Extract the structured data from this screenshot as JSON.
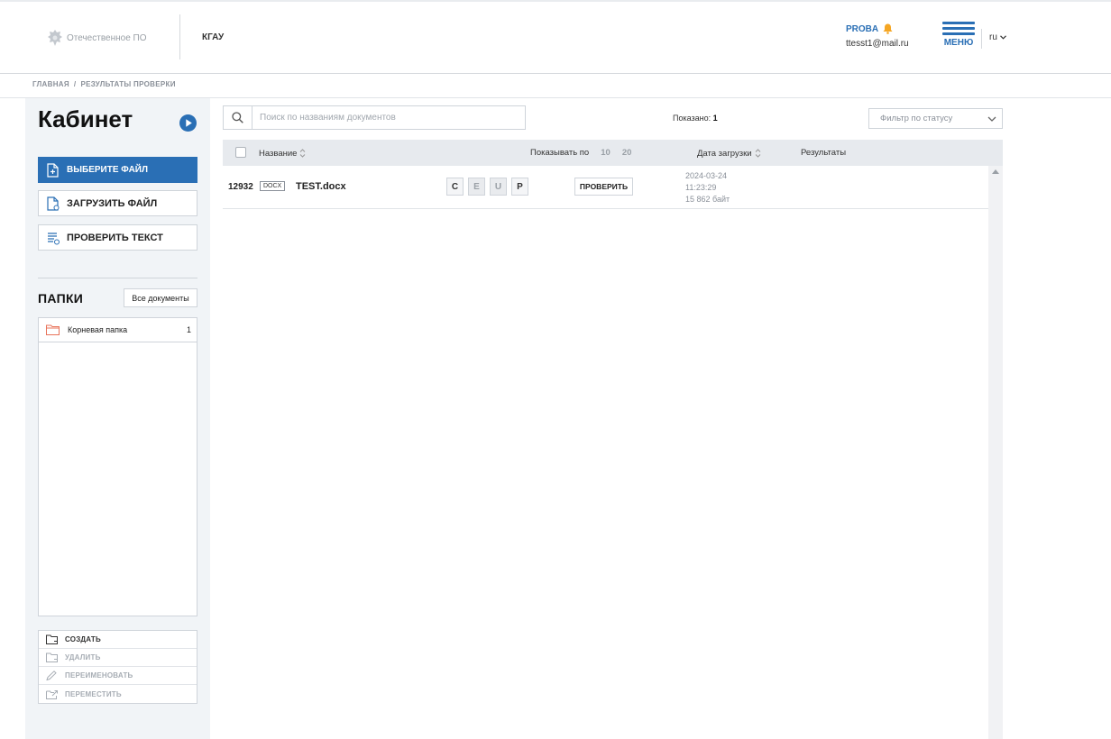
{
  "header": {
    "logo_text": "Отечественное ПО",
    "org": "КГАУ",
    "account_name": "PROBA",
    "account_email": "ttesst1@mail.ru",
    "menu_label": "МЕНЮ",
    "language": "ru",
    "accent_color": "#2a6fb5",
    "bell_color": "#f5a623"
  },
  "breadcrumb": {
    "home": "ГЛАВНАЯ",
    "separator": "/",
    "current": "РЕЗУЛЬТАТЫ ПРОВЕРКИ"
  },
  "sidebar": {
    "title": "Кабинет",
    "buttons": {
      "choose_file": "ВЫБЕРИТЕ ФАЙЛ",
      "upload_file": "ЗАГРУЗИТЬ ФАЙЛ",
      "check_text": "ПРОВЕРИТЬ ТЕКСТ"
    },
    "folders_title": "ПАПКИ",
    "all_documents": "Все документы",
    "folders": [
      {
        "name": "Корневая папка",
        "count": "1"
      }
    ],
    "actions": {
      "create": "СОЗДАТЬ",
      "delete": "УДАЛИТЬ",
      "rename": "ПЕРЕИМЕНОВАТЬ",
      "move": "ПЕРЕМЕСТИТЬ"
    }
  },
  "main": {
    "search_placeholder": "Поиск по названиям документов",
    "shown_label": "Показано:",
    "shown_count": "1",
    "status_filter": "Фильтр по статусу",
    "table": {
      "col_name": "Название",
      "per_page_label": "Показывать по",
      "per_page_options": [
        "10",
        "20"
      ],
      "col_upload_date": "Дата загрузки",
      "col_results": "Результаты"
    },
    "rows": [
      {
        "id": "12932",
        "type": "DOCX",
        "name": "TEST.docx",
        "modes": [
          "C",
          "E",
          "U",
          "P"
        ],
        "check_label": "ПРОВЕРИТЬ",
        "date": "2024-03-24",
        "time": "11:23:29",
        "size": "15 862 байт"
      }
    ]
  }
}
